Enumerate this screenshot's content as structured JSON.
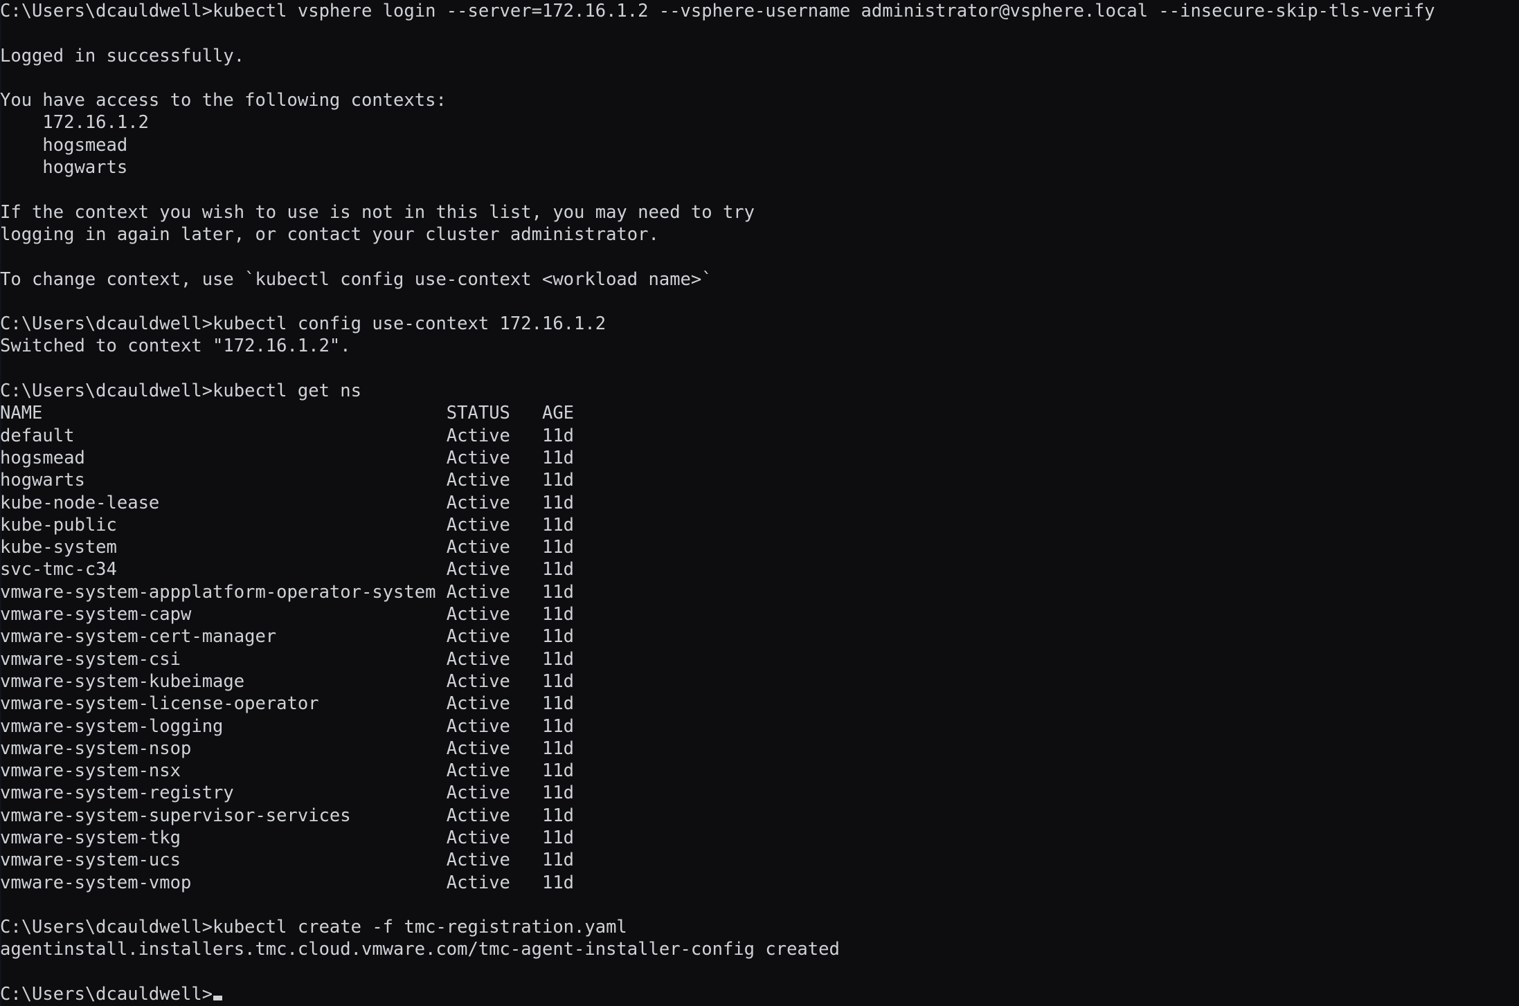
{
  "terminal": {
    "app": "Windows Command Prompt",
    "background_color": "#0d0d0f",
    "foreground_color": "#cfd2d6",
    "prompt": "C:\\Users\\dcauldwell>",
    "cursor": "block-cursor"
  },
  "session": {
    "blocks": [
      {
        "command_line": "C:\\Users\\dcauldwell>kubectl vsphere login --server=172.16.1.2 --vsphere-username administrator@vsphere.local --insecure-skip-tls-verify",
        "command": "kubectl vsphere login --server=172.16.1.2 --vsphere-username administrator@vsphere.local --insecure-skip-tls-verify"
      },
      {
        "command_line": "C:\\Users\\dcauldwell>kubectl config use-context 172.16.1.2",
        "command": "kubectl config use-context 172.16.1.2"
      },
      {
        "command_line": "C:\\Users\\dcauldwell>kubectl get ns",
        "command": "kubectl get ns"
      },
      {
        "command_line": "C:\\Users\\dcauldwell>kubectl create -f tmc-registration.yaml",
        "command": "kubectl create -f tmc-registration.yaml"
      }
    ],
    "login_output": {
      "success_message": "Logged in successfully.",
      "contexts_heading": "You have access to the following contexts:",
      "contexts": [
        "    172.16.1.2",
        "    hogsmead",
        "    hogwarts"
      ],
      "help_line_1": "If the context you wish to use is not in this list, you may need to try",
      "help_line_2": "logging in again later, or contact your cluster administrator.",
      "change_context_hint": "To change context, use `kubectl config use-context <workload name>`"
    },
    "use_context_output": "Switched to context \"172.16.1.2\".",
    "create_output": "agentinstall.installers.tmc.cloud.vmware.com/tmc-agent-installer-config created",
    "final_prompt": "C:\\Users\\dcauldwell>"
  },
  "namespaces_table": {
    "headers": [
      "NAME",
      "STATUS",
      "AGE"
    ],
    "header_line": "NAME                                      STATUS   AGE",
    "rows": [
      {
        "name": "default",
        "status": "Active",
        "age": "11d",
        "line": "default                                   Active   11d"
      },
      {
        "name": "hogsmead",
        "status": "Active",
        "age": "11d",
        "line": "hogsmead                                  Active   11d"
      },
      {
        "name": "hogwarts",
        "status": "Active",
        "age": "11d",
        "line": "hogwarts                                  Active   11d"
      },
      {
        "name": "kube-node-lease",
        "status": "Active",
        "age": "11d",
        "line": "kube-node-lease                           Active   11d"
      },
      {
        "name": "kube-public",
        "status": "Active",
        "age": "11d",
        "line": "kube-public                               Active   11d"
      },
      {
        "name": "kube-system",
        "status": "Active",
        "age": "11d",
        "line": "kube-system                               Active   11d"
      },
      {
        "name": "svc-tmc-c34",
        "status": "Active",
        "age": "11d",
        "line": "svc-tmc-c34                               Active   11d"
      },
      {
        "name": "vmware-system-appplatform-operator-system",
        "status": "Active",
        "age": "11d",
        "line": "vmware-system-appplatform-operator-system Active   11d"
      },
      {
        "name": "vmware-system-capw",
        "status": "Active",
        "age": "11d",
        "line": "vmware-system-capw                        Active   11d"
      },
      {
        "name": "vmware-system-cert-manager",
        "status": "Active",
        "age": "11d",
        "line": "vmware-system-cert-manager                Active   11d"
      },
      {
        "name": "vmware-system-csi",
        "status": "Active",
        "age": "11d",
        "line": "vmware-system-csi                         Active   11d"
      },
      {
        "name": "vmware-system-kubeimage",
        "status": "Active",
        "age": "11d",
        "line": "vmware-system-kubeimage                   Active   11d"
      },
      {
        "name": "vmware-system-license-operator",
        "status": "Active",
        "age": "11d",
        "line": "vmware-system-license-operator            Active   11d"
      },
      {
        "name": "vmware-system-logging",
        "status": "Active",
        "age": "11d",
        "line": "vmware-system-logging                     Active   11d"
      },
      {
        "name": "vmware-system-nsop",
        "status": "Active",
        "age": "11d",
        "line": "vmware-system-nsop                        Active   11d"
      },
      {
        "name": "vmware-system-nsx",
        "status": "Active",
        "age": "11d",
        "line": "vmware-system-nsx                         Active   11d"
      },
      {
        "name": "vmware-system-registry",
        "status": "Active",
        "age": "11d",
        "line": "vmware-system-registry                    Active   11d"
      },
      {
        "name": "vmware-system-supervisor-services",
        "status": "Active",
        "age": "11d",
        "line": "vmware-system-supervisor-services         Active   11d"
      },
      {
        "name": "vmware-system-tkg",
        "status": "Active",
        "age": "11d",
        "line": "vmware-system-tkg                         Active   11d"
      },
      {
        "name": "vmware-system-ucs",
        "status": "Active",
        "age": "11d",
        "line": "vmware-system-ucs                         Active   11d"
      },
      {
        "name": "vmware-system-vmop",
        "status": "Active",
        "age": "11d",
        "line": "vmware-system-vmop                        Active   11d"
      }
    ]
  }
}
